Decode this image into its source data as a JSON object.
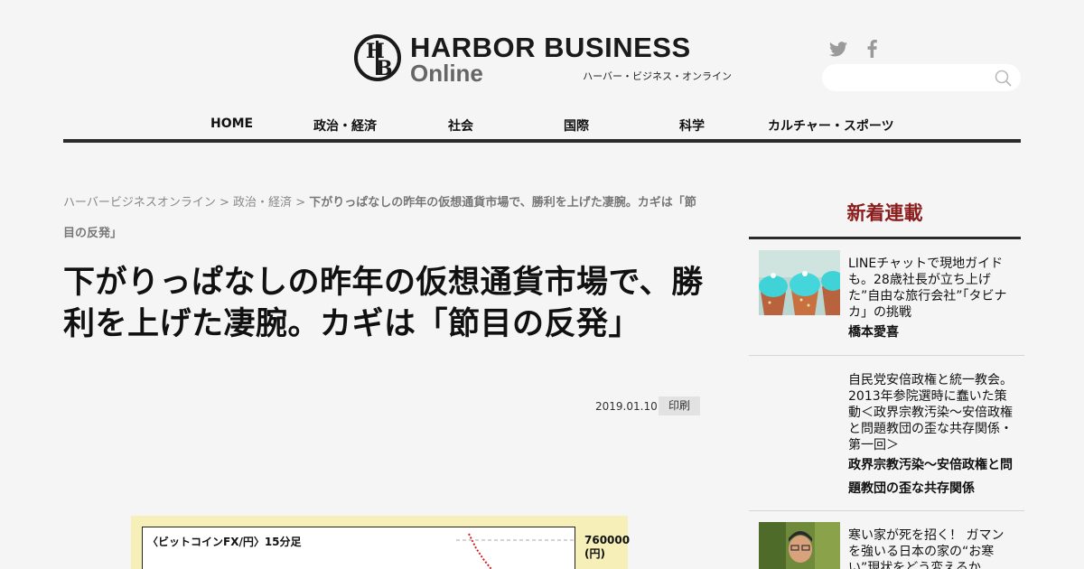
{
  "site": {
    "logo_title": "HARBOR BUSINESS",
    "logo_online": "Online",
    "logo_kana": "ハーバー・ビジネス・オンライン"
  },
  "search": {
    "placeholder": ""
  },
  "nav": {
    "items": [
      {
        "label": "HOME"
      },
      {
        "label": "政治・経済"
      },
      {
        "label": "社会"
      },
      {
        "label": "国際"
      },
      {
        "label": "科学"
      },
      {
        "label": "カルチャー・スポーツ"
      }
    ]
  },
  "breadcrumb": {
    "home": "ハーバービジネスオンライン",
    "sep": " > ",
    "category": "政治・経済",
    "current": "下がりっぱなしの昨年の仮想通貨市場で、勝利を上げた凄腕。カギは「節目の反発」"
  },
  "article": {
    "title": "下がりっぱなしの昨年の仮想通貨市場で、勝利を上げた凄腕。カギは「節目の反発」",
    "date": "2019.01.10",
    "print_label": "印刷",
    "chart_caption": "〈ビットコインFX/円〉15分足",
    "chart_ytick": "760000",
    "chart_unit": "(円)"
  },
  "sidebar": {
    "heading": "新着連載",
    "items": [
      {
        "title": "LINEチャットで現地ガイドも。28歳社長が立ち上げた”自由な旅行会社”「タビナカ」の挑戦",
        "author": "橋本愛喜"
      },
      {
        "title": "自民党安倍政権と統一教会。2013年参院選時に蠢いた策動＜政界宗教汚染〜安倍政権と問題教団の歪な共存関係・第一回＞",
        "author": "政界宗教汚染〜安倍政権と問題教団の歪な共存関係"
      },
      {
        "title": "寒い家が死を招く！ ガマンを強いる日本の家の“お寒い”現状をどう変えるか",
        "author": ""
      }
    ]
  },
  "colors": {
    "background": "#f5f5f5",
    "sidebar_heading": "#8b1d1d",
    "nav_border": "#2b2b2b"
  }
}
